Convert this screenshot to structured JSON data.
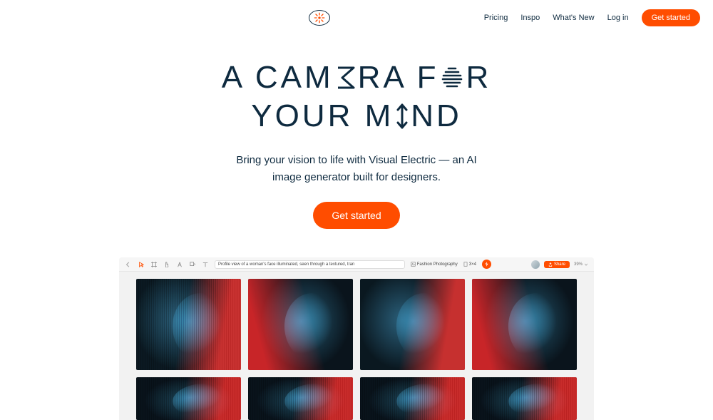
{
  "header": {
    "nav": {
      "pricing": "Pricing",
      "inspo": "Inspo",
      "whatsnew": "What's New",
      "login": "Log in"
    },
    "cta": "Get started"
  },
  "hero": {
    "title_line1_pre": "A CAM",
    "title_line1_post": "RA F",
    "title_line1_end": "R",
    "title_line2_pre": "YOUR M",
    "title_line2_post": "ND",
    "subtitle_line1": "Bring your vision to life with Visual Electric — an AI",
    "subtitle_line2": "image generator built for designers.",
    "cta": "Get started"
  },
  "app": {
    "prompt": "Profile view of a woman's face illuminated, seen through a textured, tran",
    "style_label": "Fashion Photography",
    "ratio": "3×4",
    "share": "Share",
    "zoom": "39%"
  },
  "colors": {
    "accent": "#ff4d00",
    "ink": "#0e2a3f"
  }
}
